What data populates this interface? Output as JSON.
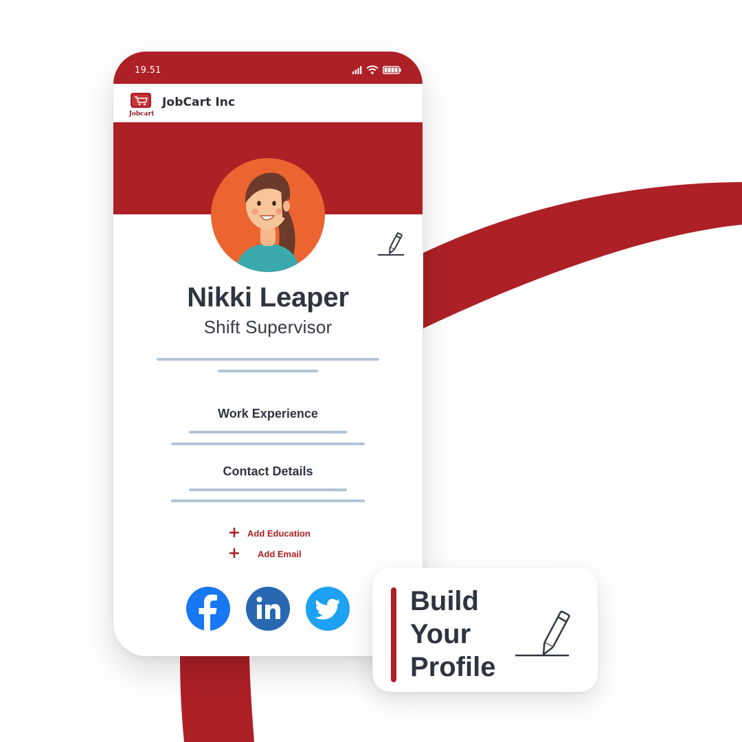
{
  "colors": {
    "brand_red": "#ac2026",
    "text_dark": "#2f3440",
    "line_blue": "#b4c4d8"
  },
  "status_bar": {
    "time": "19.51",
    "icons": [
      "signal-icon",
      "wifi-icon",
      "battery-icon"
    ]
  },
  "app_bar": {
    "logo_text": "Jobcart",
    "company_name": "JobCart Inc"
  },
  "profile": {
    "name": "Nikki Leaper",
    "role": "Shift Supervisor",
    "sections": [
      {
        "title": "Work Experience"
      },
      {
        "title": "Contact Details"
      }
    ],
    "actions": [
      {
        "label": "Add Education",
        "icon": "plus-icon"
      },
      {
        "label": "Add Email",
        "icon": "plus-icon"
      }
    ],
    "social": [
      {
        "name": "facebook",
        "color": "#1877f2"
      },
      {
        "name": "linkedin",
        "color": "#2867b2"
      },
      {
        "name": "twitter",
        "color": "#1da1f2"
      }
    ]
  },
  "callout": {
    "lines": [
      "Build",
      "Your",
      "Profile"
    ],
    "icon": "pencil-icon"
  }
}
